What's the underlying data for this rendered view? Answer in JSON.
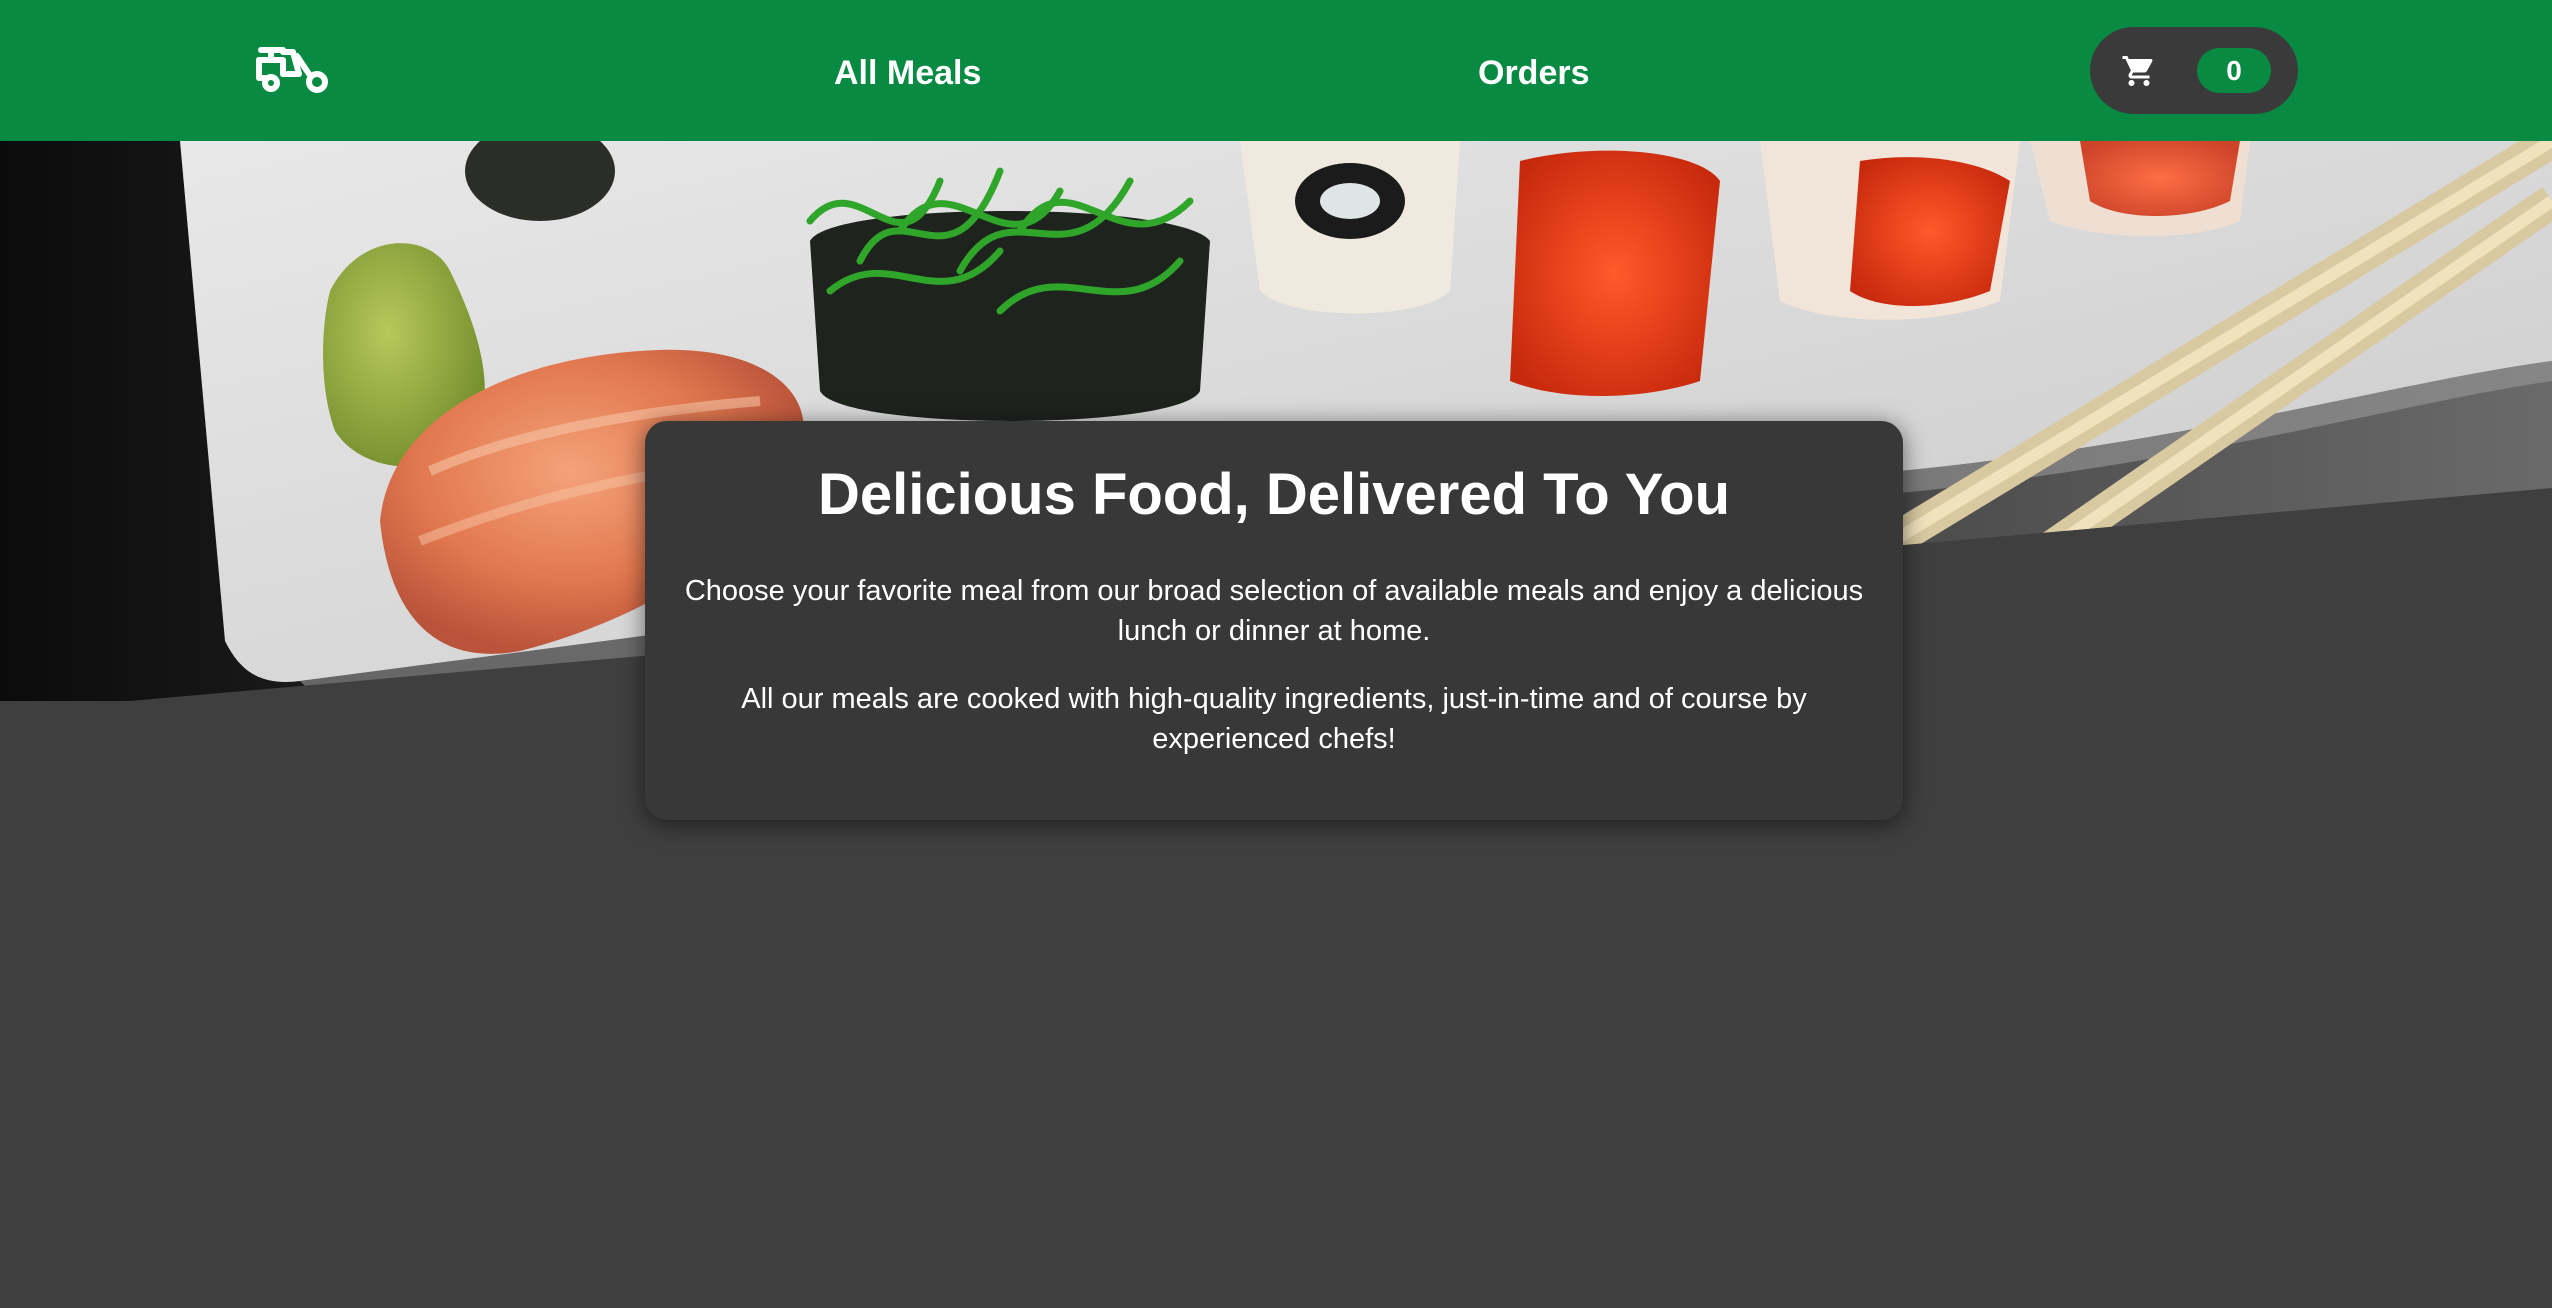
{
  "header": {
    "logo_icon": "scooter-icon",
    "nav": {
      "meals_label": "All Meals",
      "orders_label": "Orders"
    },
    "cart": {
      "icon": "shopping-cart-icon",
      "count": "0"
    }
  },
  "summary": {
    "title": "Delicious Food, Delivered To You",
    "paragraph_1": "Choose your favorite meal from our broad selection of available meals and enjoy a delicious lunch or dinner at home.",
    "paragraph_2": "All our meals are cooked with high-quality ingredients, just-in-time and of course by experienced chefs!"
  },
  "colors": {
    "brand_green": "#088a42",
    "background": "#3f3f3f",
    "card": "#383838",
    "text": "#ffffff"
  }
}
